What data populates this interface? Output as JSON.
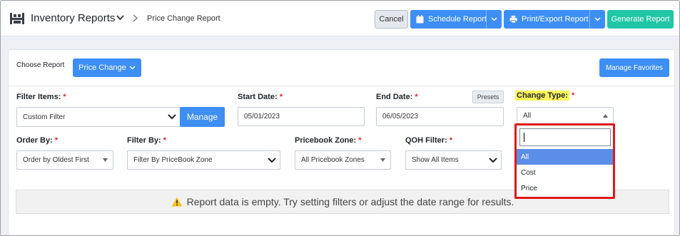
{
  "header": {
    "app_title": "Inventory Reports",
    "breadcrumb": "Price Change Report",
    "buttons": {
      "cancel": "Cancel",
      "schedule": "Schedule Report",
      "print_export": "Print/Export Report",
      "generate": "Generate Report"
    }
  },
  "report_chooser": {
    "label": "Choose Report",
    "selected": "Price Change",
    "manage_favorites": "Manage Favorites"
  },
  "filters": {
    "filter_items": {
      "label": "Filter Items:",
      "required": "*",
      "value": "Custom Filter",
      "manage_label": "Manage"
    },
    "start_date": {
      "label": "Start Date:",
      "required": "*",
      "value": "05/01/2023"
    },
    "end_date": {
      "label": "End Date:",
      "required": "*",
      "value": "06/05/2023",
      "presets_label": "Presets"
    },
    "change_type": {
      "label": "Change Type:",
      "required": "*",
      "value": "All"
    },
    "order_by": {
      "label": "Order By:",
      "required": "*",
      "value": "Order by Oldest First"
    },
    "filter_by": {
      "label": "Filter By:",
      "required": "*",
      "value": "Filter By PriceBook Zone"
    },
    "pricebook_zone": {
      "label": "Pricebook Zone:",
      "required": "*",
      "value": "All Pricebook Zones"
    },
    "qoh_filter": {
      "label": "QOH Filter:",
      "required": "*",
      "value": "Show All Items"
    }
  },
  "change_type_dropdown": {
    "search_value": "",
    "options": [
      "All",
      "Cost",
      "Price"
    ],
    "active_option": "All"
  },
  "notice": {
    "icon": "warning-icon",
    "text": "Report data is empty. Try setting filters or adjust the date range for results."
  },
  "colors": {
    "primary": "#3d8ef5",
    "generate": "#20c6a6",
    "highlight": "#fff45a",
    "dropdown_border": "#e01818",
    "required": "#e0262b"
  }
}
